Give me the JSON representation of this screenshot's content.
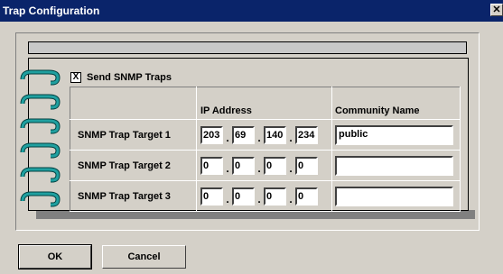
{
  "window": {
    "title": "Trap Configuration",
    "close_glyph": "✕"
  },
  "send_traps": {
    "label": "Send SNMP Traps",
    "checked": true,
    "check_glyph": "X"
  },
  "table": {
    "ip_header": "IP Address",
    "community_header": "Community Name",
    "rows": [
      {
        "label": "SNMP Trap Target 1",
        "ip": [
          "203",
          "69",
          "140",
          "234"
        ],
        "community": "public"
      },
      {
        "label": "SNMP Trap Target 2",
        "ip": [
          "0",
          "0",
          "0",
          "0"
        ],
        "community": ""
      },
      {
        "label": "SNMP Trap Target 3",
        "ip": [
          "0",
          "0",
          "0",
          "0"
        ],
        "community": ""
      }
    ]
  },
  "buttons": {
    "ok": "OK",
    "cancel": "Cancel"
  },
  "colors": {
    "titlebar": "#0a246a",
    "ring": "#008080",
    "face": "#d4d0c8"
  },
  "icons": {
    "binder": "binder-ring-icon",
    "close": "close-icon",
    "check": "check-icon"
  }
}
